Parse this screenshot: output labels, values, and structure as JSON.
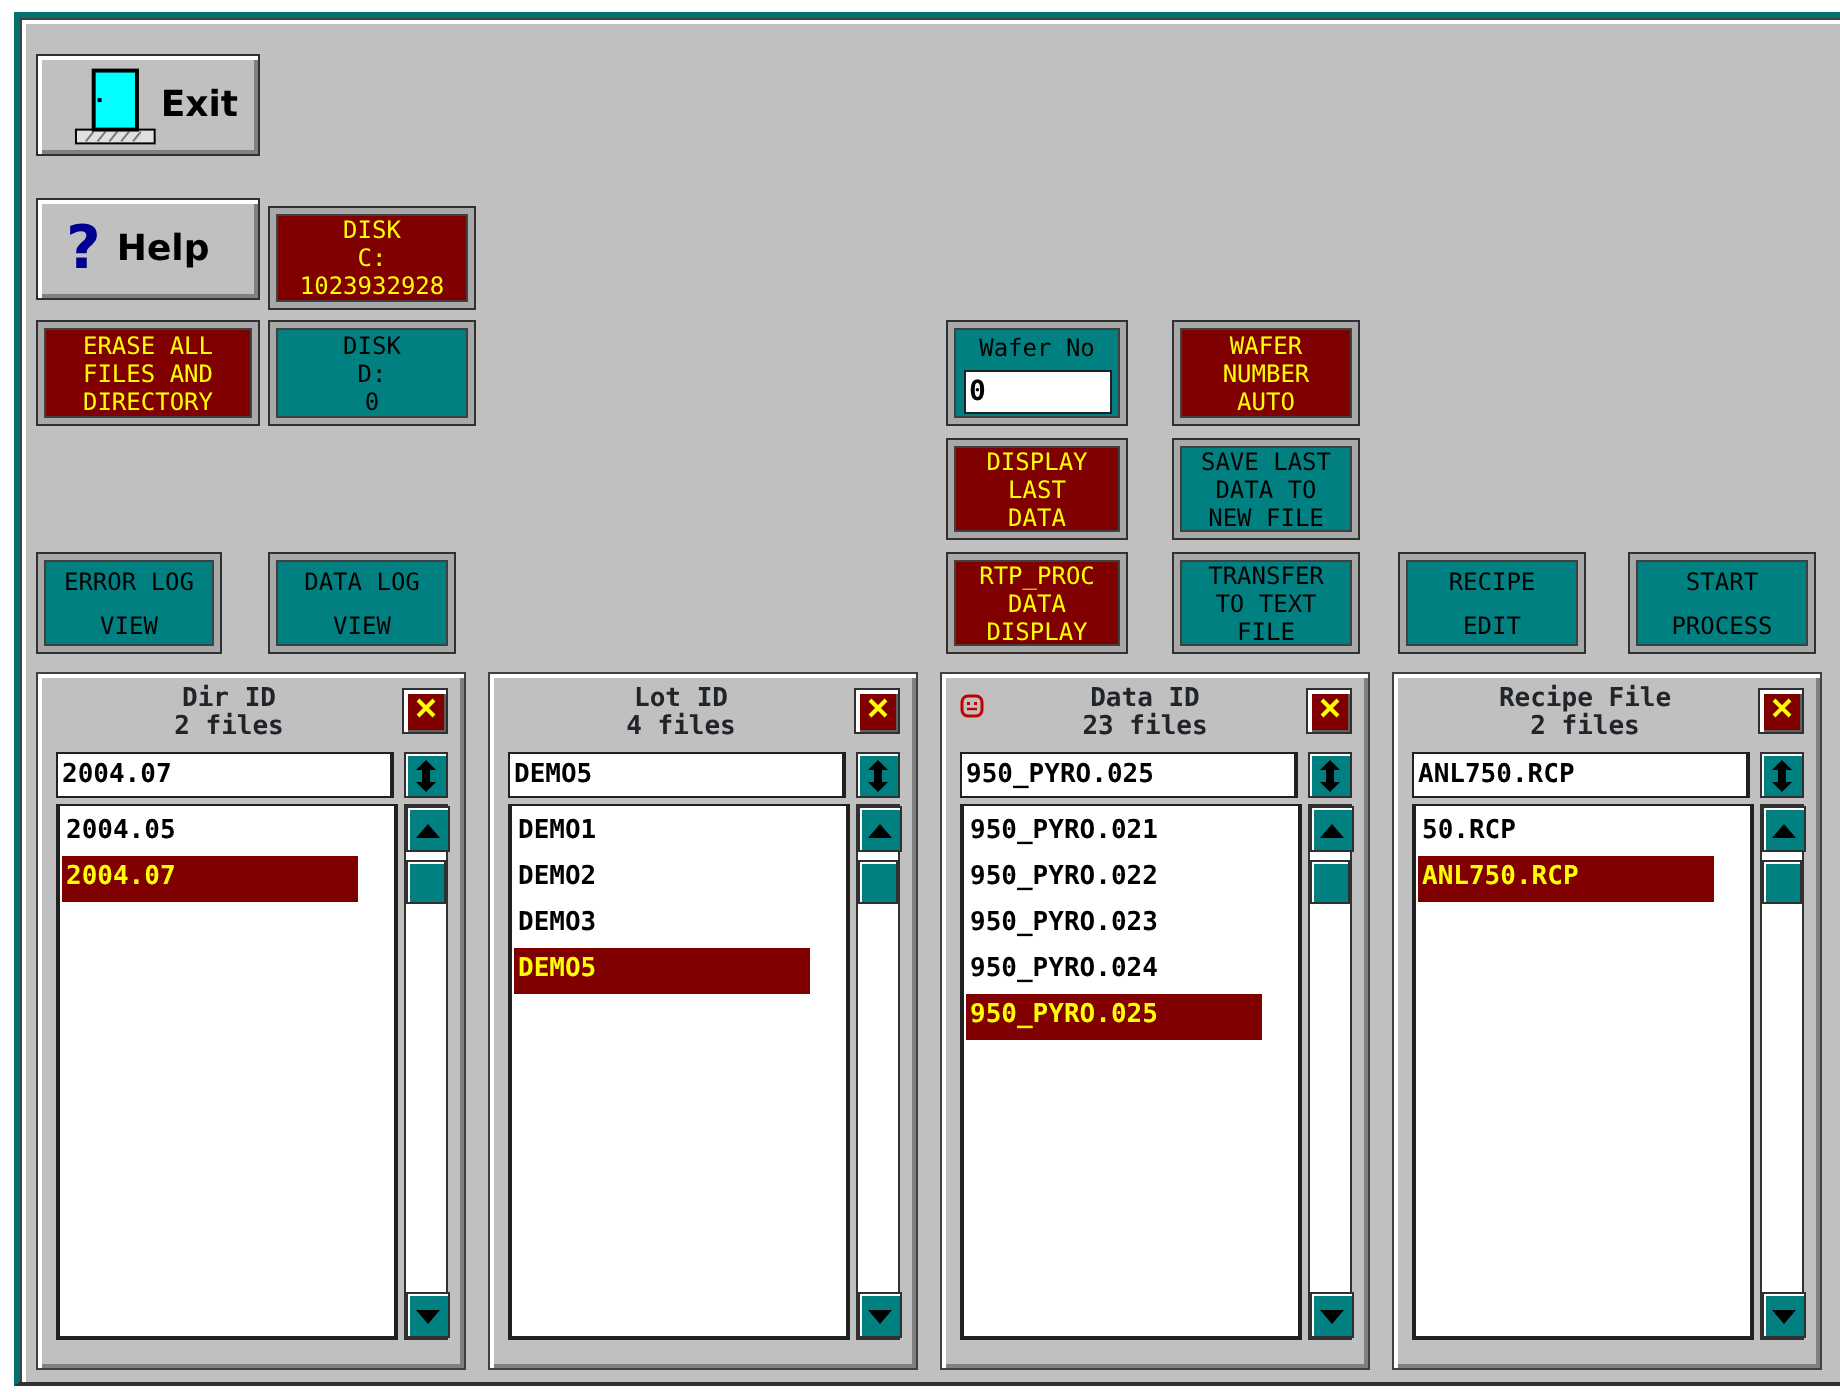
{
  "buttons": [
    {
      "kind": "gray",
      "label": "Exit"
    },
    {
      "kind": "gray",
      "glyph": "?",
      "label": "Help"
    },
    {
      "kind": "colored",
      "color": "#800000",
      "label": "DISK\nC:\n1023932928"
    },
    {
      "kind": "colored",
      "color": "#800000",
      "label": "ERASE ALL\nFILES AND\nDIRECTORY"
    },
    {
      "kind": "colored",
      "color": "#008080",
      "label": "DISK\nD:\n0"
    },
    {
      "kind": "colored",
      "color": "#008080",
      "label": "ERROR LOG\nVIEW"
    },
    {
      "kind": "colored",
      "color": "#008080",
      "label": "DATA LOG\nVIEW"
    },
    {
      "kind": "field",
      "color": "#008080",
      "label": "Wafer No",
      "value": "0"
    },
    {
      "kind": "colored",
      "color": "#800000",
      "label": "WAFER\nNUMBER\nAUTO"
    },
    {
      "kind": "colored",
      "color": "#800000",
      "label": "DISPLAY\nLAST\nDATA"
    },
    {
      "kind": "colored",
      "color": "#008080",
      "label": "SAVE LAST\nDATA TO\nNEW FILE"
    },
    {
      "kind": "colored",
      "color": "#800000",
      "label": "RTP_PROC\nDATA\nDISPLAY"
    },
    {
      "kind": "colored",
      "color": "#008080",
      "label": "TRANSFER\nTO TEXT\nFILE"
    },
    {
      "kind": "colored",
      "color": "#008080",
      "label": "RECIPE\nEDIT"
    },
    {
      "kind": "colored",
      "color": "#008080",
      "label": "START\nPROCESS"
    }
  ],
  "panels": [
    {
      "title": "Dir ID",
      "count": "2 files",
      "value": "2004.07",
      "flagged": false,
      "items": [
        {
          "label": "2004.05",
          "selected": false
        },
        {
          "label": "2004.07",
          "selected": true
        }
      ]
    },
    {
      "title": "Lot ID",
      "count": "4 files",
      "value": "DEMO5",
      "flagged": false,
      "items": [
        {
          "label": "DEMO1",
          "selected": false
        },
        {
          "label": "DEMO2",
          "selected": false
        },
        {
          "label": "DEMO3",
          "selected": false
        },
        {
          "label": "DEMO5",
          "selected": true
        }
      ]
    },
    {
      "title": "Data ID",
      "count": "23 files",
      "value": "950_PYRO.025",
      "flagged": true,
      "items": [
        {
          "label": "950_PYRO.021",
          "selected": false
        },
        {
          "label": "950_PYRO.022",
          "selected": false
        },
        {
          "label": "950_PYRO.023",
          "selected": false
        },
        {
          "label": "950_PYRO.024",
          "selected": false
        },
        {
          "label": "950_PYRO.025",
          "selected": true
        }
      ]
    },
    {
      "title": "Recipe File",
      "count": "2 files",
      "value": "ANL750.RCP",
      "flagged": false,
      "items": [
        {
          "label": "50.RCP",
          "selected": false
        },
        {
          "label": "ANL750.RCP",
          "selected": true
        }
      ]
    }
  ]
}
